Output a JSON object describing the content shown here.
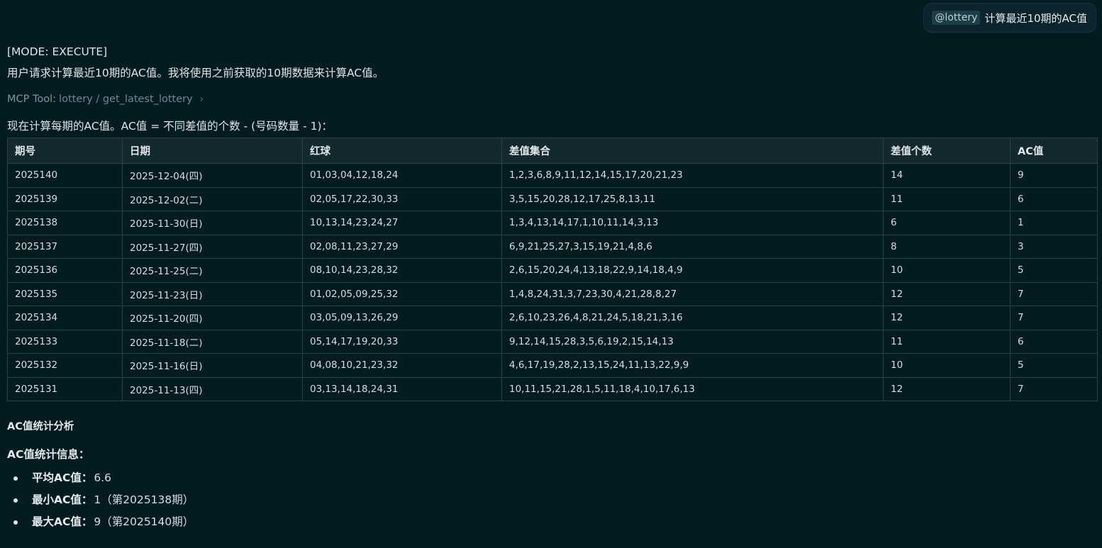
{
  "user_message": {
    "mention": "@lottery",
    "text": "计算最近10期的AC值"
  },
  "assistant": {
    "mode": "[MODE: EXECUTE]",
    "intro": "用户请求计算最近10期的AC值。我将使用之前获取的10期数据来计算AC值。",
    "tool": {
      "label": "MCP Tool:",
      "path": "lottery / get_latest_lottery"
    },
    "formula": "现在计算每期的AC值。AC值 = 不同差值的个数 - (号码数量 - 1)："
  },
  "table": {
    "headers": [
      "期号",
      "日期",
      "红球",
      "差值集合",
      "差值个数",
      "AC值"
    ],
    "rows": [
      [
        "2025140",
        "2025-12-04(四)",
        "01,03,04,12,18,24",
        "1,2,3,6,8,9,11,12,14,15,17,20,21,23",
        "14",
        "9"
      ],
      [
        "2025139",
        "2025-12-02(二)",
        "02,05,17,22,30,33",
        "3,5,15,20,28,12,17,25,8,13,11",
        "11",
        "6"
      ],
      [
        "2025138",
        "2025-11-30(日)",
        "10,13,14,23,24,27",
        "1,3,4,13,14,17,1,10,11,14,3,13",
        "6",
        "1"
      ],
      [
        "2025137",
        "2025-11-27(四)",
        "02,08,11,23,27,29",
        "6,9,21,25,27,3,15,19,21,4,8,6",
        "8",
        "3"
      ],
      [
        "2025136",
        "2025-11-25(二)",
        "08,10,14,23,28,32",
        "2,6,15,20,24,4,13,18,22,9,14,18,4,9",
        "10",
        "5"
      ],
      [
        "2025135",
        "2025-11-23(日)",
        "01,02,05,09,25,32",
        "1,4,8,24,31,3,7,23,30,4,21,28,8,27",
        "12",
        "7"
      ],
      [
        "2025134",
        "2025-11-20(四)",
        "03,05,09,13,26,29",
        "2,6,10,23,26,4,8,21,24,5,18,21,3,16",
        "12",
        "7"
      ],
      [
        "2025133",
        "2025-11-18(二)",
        "05,14,17,19,20,33",
        "9,12,14,15,28,3,5,6,19,2,15,14,13",
        "11",
        "6"
      ],
      [
        "2025132",
        "2025-11-16(日)",
        "04,08,10,21,23,32",
        "4,6,17,19,28,2,13,15,24,11,13,22,9,9",
        "10",
        "5"
      ],
      [
        "2025131",
        "2025-11-13(四)",
        "03,13,14,18,24,31",
        "10,11,15,21,28,1,5,11,18,4,10,17,6,13",
        "12",
        "7"
      ]
    ]
  },
  "analysis": {
    "section_title": "AC值统计分析",
    "stats_title": "AC值统计信息：",
    "items": [
      {
        "label": "平均AC值：",
        "value": "6.6"
      },
      {
        "label": "最小AC值：",
        "value": "1（第2025138期）"
      },
      {
        "label": "最大AC值：",
        "value": "9（第2025140期）"
      }
    ]
  }
}
